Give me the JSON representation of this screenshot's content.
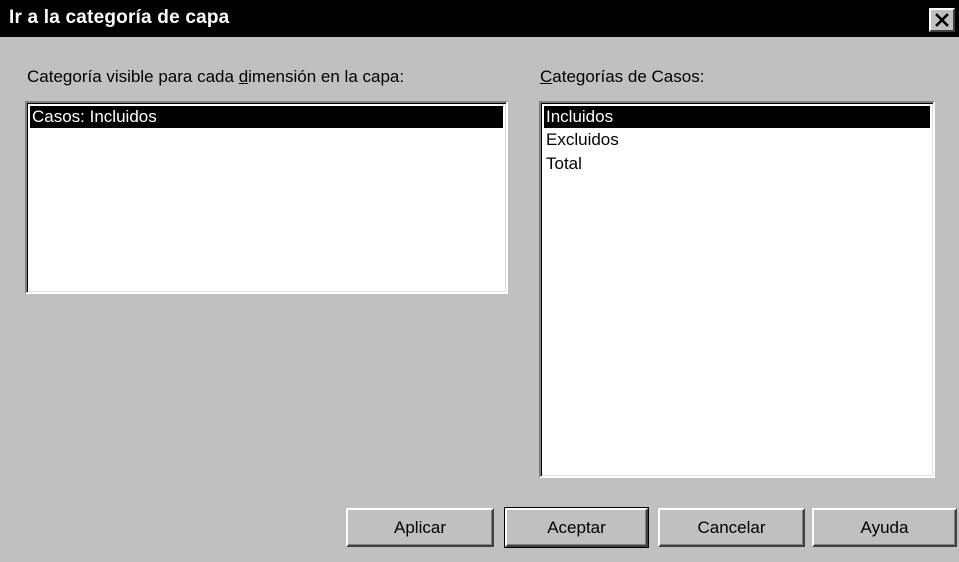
{
  "window": {
    "title": "Ir a la categoría de capa",
    "close_icon": "close-icon"
  },
  "left_panel": {
    "label_before": "Categoría visible para cada ",
    "label_mnemonic": "d",
    "label_after": "imensión en la capa:",
    "items": [
      {
        "label": "Casos: Incluidos",
        "selected": true
      }
    ]
  },
  "right_panel": {
    "label_mnemonic": "C",
    "label_after": "ategorías de Casos:",
    "items": [
      {
        "label": "Incluidos",
        "selected": true
      },
      {
        "label": "Excluidos",
        "selected": false
      },
      {
        "label": "Total",
        "selected": false
      }
    ]
  },
  "buttons": {
    "apply": "Aplicar",
    "ok": "Aceptar",
    "cancel": "Cancelar",
    "help": "Ayuda"
  },
  "colors": {
    "face": "#c0c0c0",
    "titlebar": "#000000",
    "selection": "#000000"
  }
}
